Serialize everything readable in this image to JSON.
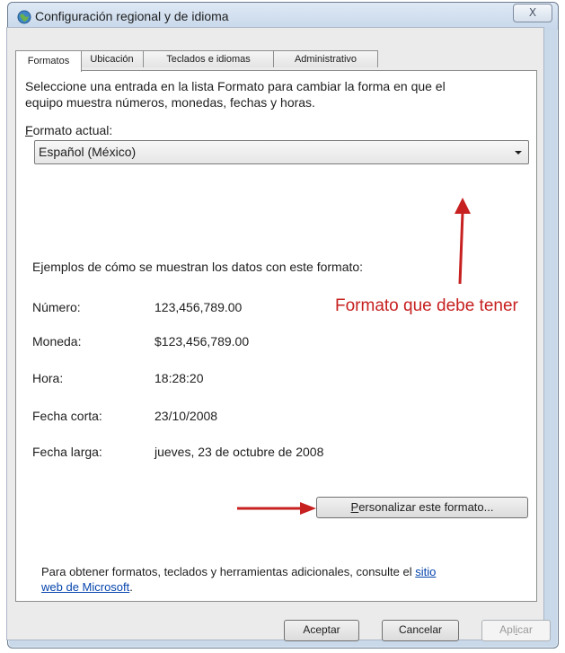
{
  "window": {
    "title": "Configuración regional y de idioma",
    "close_label": "X"
  },
  "tabs": [
    {
      "label": "Formatos",
      "active": true
    },
    {
      "label": "Ubicación",
      "active": false
    },
    {
      "label": "Teclados e idiomas",
      "active": false
    },
    {
      "label": "Administrativo",
      "active": false
    }
  ],
  "formats": {
    "intro_line1": "Seleccione una entrada en la lista Formato para cambiar la forma en que el",
    "intro_line2": "equipo muestra números, monedas, fechas y horas.",
    "current_format_label_access": "F",
    "current_format_label_rest": "ormato actual:",
    "current_format_value": "Español (México)",
    "examples_heading": "Ejemplos de cómo se muestran los datos con este formato:",
    "examples": [
      {
        "label": "Número:",
        "value": "123,456,789.00"
      },
      {
        "label": "Moneda:",
        "value": "$123,456,789.00"
      },
      {
        "label": "Hora:",
        "value": "18:28:20"
      },
      {
        "label": "Fecha corta:",
        "value": "23/10/2008"
      },
      {
        "label": "Fecha larga:",
        "value": "jueves, 23 de octubre de 2008"
      }
    ],
    "customize_access": "P",
    "customize_rest": "ersonalizar este formato...",
    "footer_text": "Para obtener formatos, teclados y herramientas adicionales, consulte el",
    "footer_link_part1": "sitio",
    "footer_link_part2": "web de Microsoft",
    "footer_end": "."
  },
  "annotation": {
    "text": "Formato que debe tener",
    "color": "#c72020"
  },
  "footer_buttons": {
    "ok": "Aceptar",
    "cancel": "Cancelar",
    "apply_pre": "Apl",
    "apply_access": "i",
    "apply_post": "car"
  },
  "colors": {
    "chrome": "#c9d9ea",
    "panel": "#ffffff",
    "link": "#0645ad"
  },
  "icons": {
    "title": "globe-icon",
    "arrow_up": "red-arrow-up-icon",
    "arrow_right": "red-arrow-right-icon"
  }
}
